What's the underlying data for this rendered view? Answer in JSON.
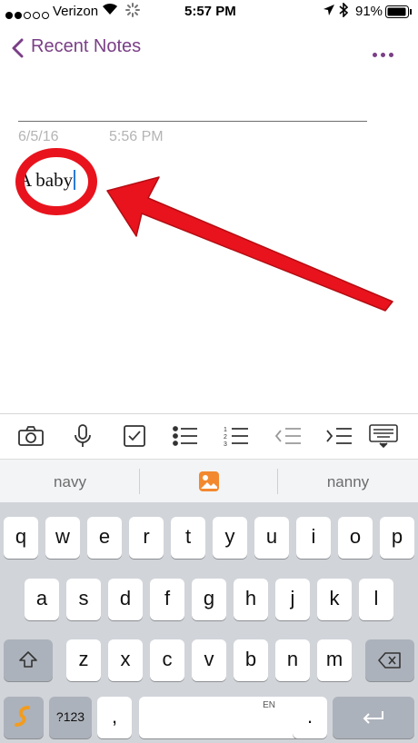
{
  "status_bar": {
    "carrier": "Verizon",
    "time": "5:57 PM",
    "battery": "91%",
    "signal_dots_filled": 2,
    "signal_dots_total": 5
  },
  "nav": {
    "back_label": "Recent Notes"
  },
  "note": {
    "date": "6/5/16",
    "time": "5:56 PM",
    "text": "A baby"
  },
  "suggestions": [
    "navy",
    "nanny"
  ],
  "keyboard": {
    "row1": [
      "q",
      "w",
      "e",
      "r",
      "t",
      "y",
      "u",
      "i",
      "o",
      "p"
    ],
    "row2": [
      "a",
      "s",
      "d",
      "f",
      "g",
      "h",
      "j",
      "k",
      "l"
    ],
    "row3": [
      "z",
      "x",
      "c",
      "v",
      "b",
      "n",
      "m"
    ],
    "numbers_label": "?123",
    "comma": ",",
    "period": ".",
    "space_lang": "EN"
  },
  "colors": {
    "accent": "#7a3f86",
    "annotation": "#e8131d"
  }
}
